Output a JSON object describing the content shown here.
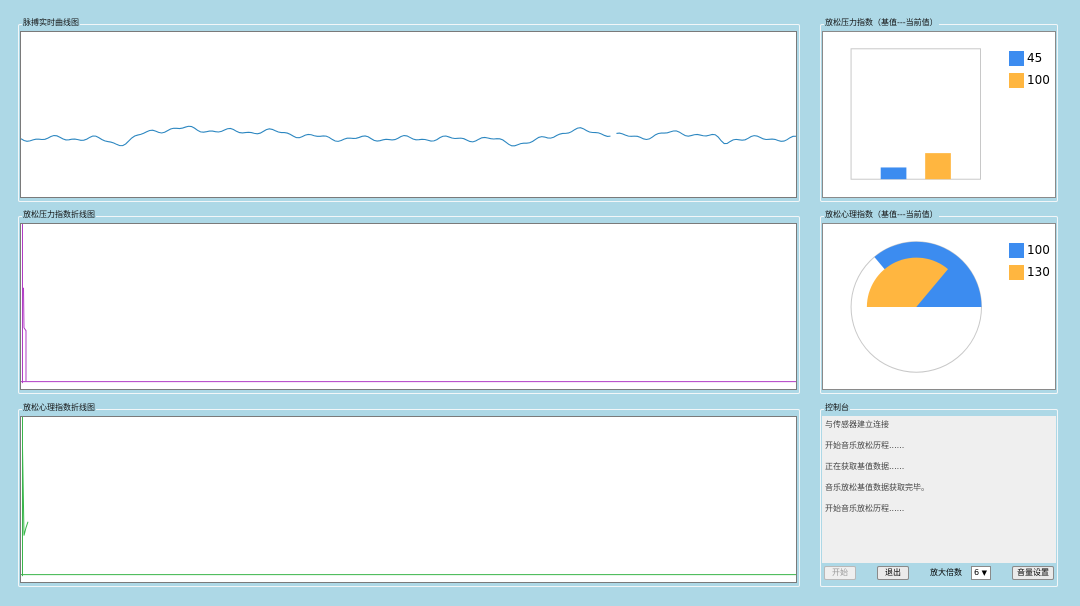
{
  "panels": {
    "pulse": {
      "title": "脉搏实时曲线图"
    },
    "stress_line": {
      "title": "放松压力指数折线图"
    },
    "mental_line": {
      "title": "放松心理指数折线图"
    },
    "stress_index": {
      "title": "放松压力指数（基值---当前值）"
    },
    "mental_index": {
      "title": "放松心理指数（基值---当前值）"
    },
    "console": {
      "title": "控制台"
    }
  },
  "colors": {
    "background": "#add8e6",
    "base": "#3c8cf0",
    "current": "#ffb640",
    "pulse_line": "#2b86c0",
    "stress_line": "#b03cc4",
    "mental_line": "#39b54a"
  },
  "stress_index": {
    "legend": [
      {
        "value": "45",
        "color": "#3c8cf0"
      },
      {
        "value": "100",
        "color": "#ffb640"
      }
    ],
    "chart_data": {
      "type": "bar",
      "values": [
        45,
        100
      ],
      "ylim": [
        0,
        500
      ]
    }
  },
  "mental_index": {
    "legend": [
      {
        "value": "100",
        "color": "#3c8cf0"
      },
      {
        "value": "130",
        "color": "#ffb640"
      }
    ],
    "chart_data": {
      "type": "pie",
      "values": [
        100,
        130
      ],
      "max": 180
    }
  },
  "console": {
    "log": [
      "与传感器建立连接",
      "开始音乐放松历程......",
      "正在获取基值数据......",
      "音乐放松基值数据获取完毕。",
      "开始音乐放松历程......"
    ],
    "start_label": "开始",
    "exit_label": "退出",
    "gain_label": "放大倍数",
    "gain_value": "6",
    "volume_label": "音量设置"
  }
}
